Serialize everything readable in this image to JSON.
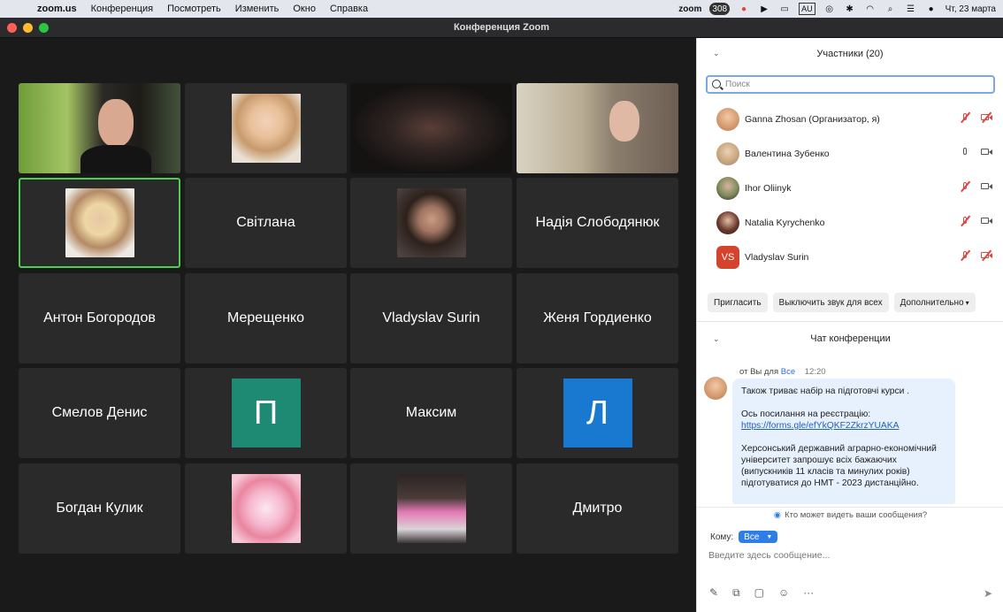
{
  "menubar": {
    "app": "zoom.us",
    "items": [
      "Конференция",
      "Посмотреть",
      "Изменить",
      "Окно",
      "Справка"
    ],
    "status": {
      "zoom_label": "zoom",
      "badge_count": "308",
      "lang": "AU",
      "datetime": "Чт, 23 марта"
    }
  },
  "window": {
    "title": "Конференция Zoom"
  },
  "gallery": {
    "tiles": [
      {
        "type": "video",
        "label": ""
      },
      {
        "type": "avatar",
        "label": ""
      },
      {
        "type": "video",
        "label": ""
      },
      {
        "type": "video",
        "label": ""
      },
      {
        "type": "avatar",
        "label": "",
        "active": true
      },
      {
        "type": "name",
        "label": "Світлана"
      },
      {
        "type": "avatar",
        "label": ""
      },
      {
        "type": "name",
        "label": "Надія Слободянюк"
      },
      {
        "type": "name",
        "label": "Антон Богородов"
      },
      {
        "type": "name",
        "label": "Мерещенко"
      },
      {
        "type": "name",
        "label": "Vladyslav Surin"
      },
      {
        "type": "name",
        "label": "Женя Гордиенко"
      },
      {
        "type": "name",
        "label": "Смелов Денис"
      },
      {
        "type": "initial",
        "label": "П",
        "color": "#1e8a74"
      },
      {
        "type": "name",
        "label": "Максим"
      },
      {
        "type": "initial",
        "label": "Л",
        "color": "#1978d0"
      },
      {
        "type": "name",
        "label": "Богдан Кулик"
      },
      {
        "type": "avatar",
        "label": ""
      },
      {
        "type": "avatar",
        "label": ""
      },
      {
        "type": "name",
        "label": "Дмитро"
      }
    ]
  },
  "participants": {
    "title": "Участники (20)",
    "search_placeholder": "Поиск",
    "list": [
      {
        "name": "Ganna Zhosan (Организатор, я)",
        "mic": "muted",
        "cam": "off"
      },
      {
        "name": "Валентина Зубенко",
        "mic": "on",
        "cam": "on"
      },
      {
        "name": "Ihor Oliinyk",
        "mic": "muted",
        "cam": "on"
      },
      {
        "name": "Natalia Kyrychenko",
        "mic": "muted",
        "cam": "on"
      },
      {
        "name": "Vladyslav Surin",
        "initials": "VS",
        "mic": "muted",
        "cam": "off"
      }
    ],
    "buttons": {
      "invite": "Пригласить",
      "mute_all": "Выключить звук для всех",
      "more": "Дополнительно"
    }
  },
  "chat": {
    "title": "Чат конференции",
    "message": {
      "from": "от Вы для",
      "to": "Все",
      "time": "12:20",
      "p1": "Також триває набір на підготовчі курси .",
      "p2_prefix": "Ось посилання на реєстрацію: ",
      "link": "https://forms.gle/efYkQKF2ZkrzYUAKA",
      "p3": "Херсонський державний аграрно-економічний університет запрошує всіх бажаючих (випускників 11 класів та минулих років) підготуватися до НМТ - 2023 дистанційно."
    },
    "who_sees": "Кто может видеть ваши сообщения?",
    "to_label": "Кому:",
    "to_value": "Все",
    "input_placeholder": "Введите здесь сообщение..."
  },
  "colors": {
    "accent_green": "#4fcf52",
    "brand_blue": "#2d7ee8",
    "mute_red": "#e0443e",
    "bubble_bg": "#e6f1fd"
  }
}
